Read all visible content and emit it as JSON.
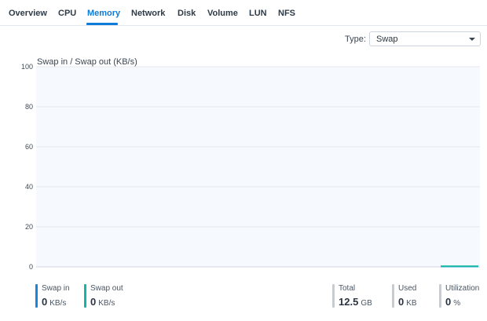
{
  "tabs": [
    {
      "label": "Overview",
      "active": false
    },
    {
      "label": "CPU",
      "active": false
    },
    {
      "label": "Memory",
      "active": true
    },
    {
      "label": "Network",
      "active": false
    },
    {
      "label": "Disk",
      "active": false
    },
    {
      "label": "Volume",
      "active": false
    },
    {
      "label": "LUN",
      "active": false
    },
    {
      "label": "NFS",
      "active": false
    }
  ],
  "type_selector": {
    "label": "Type:",
    "value": "Swap",
    "icon": "caret-down-icon"
  },
  "chart": {
    "title": "Swap in / Swap out (KB/s)"
  },
  "chart_data": {
    "type": "line",
    "title": "Swap in / Swap out (KB/s)",
    "ylim": [
      0,
      100
    ],
    "yticks": [
      0,
      20,
      40,
      60,
      80,
      100
    ],
    "grid": true,
    "series": [
      {
        "name": "Swap in",
        "color": "#1a86d9",
        "values": [
          0
        ]
      },
      {
        "name": "Swap out",
        "color": "#12b5a6",
        "values": [
          0
        ]
      }
    ]
  },
  "stats": [
    {
      "label": "Swap in",
      "value": "0",
      "unit": "KB/s",
      "color": "#1a86d9"
    },
    {
      "label": "Swap out",
      "value": "0",
      "unit": "KB/s",
      "color": "#12b5a6"
    },
    {
      "label": "Total",
      "value": "12.5",
      "unit": "GB",
      "color": "#c7ccd3"
    },
    {
      "label": "Used",
      "value": "0",
      "unit": "KB",
      "color": "#c7ccd3"
    },
    {
      "label": "Utilization",
      "value": "0",
      "unit": "%",
      "color": "#c7ccd3"
    }
  ],
  "colors": {
    "accent": "#0f7bd8",
    "chart_bg": "#f6f9fd",
    "grid": "#e4e9f0"
  }
}
